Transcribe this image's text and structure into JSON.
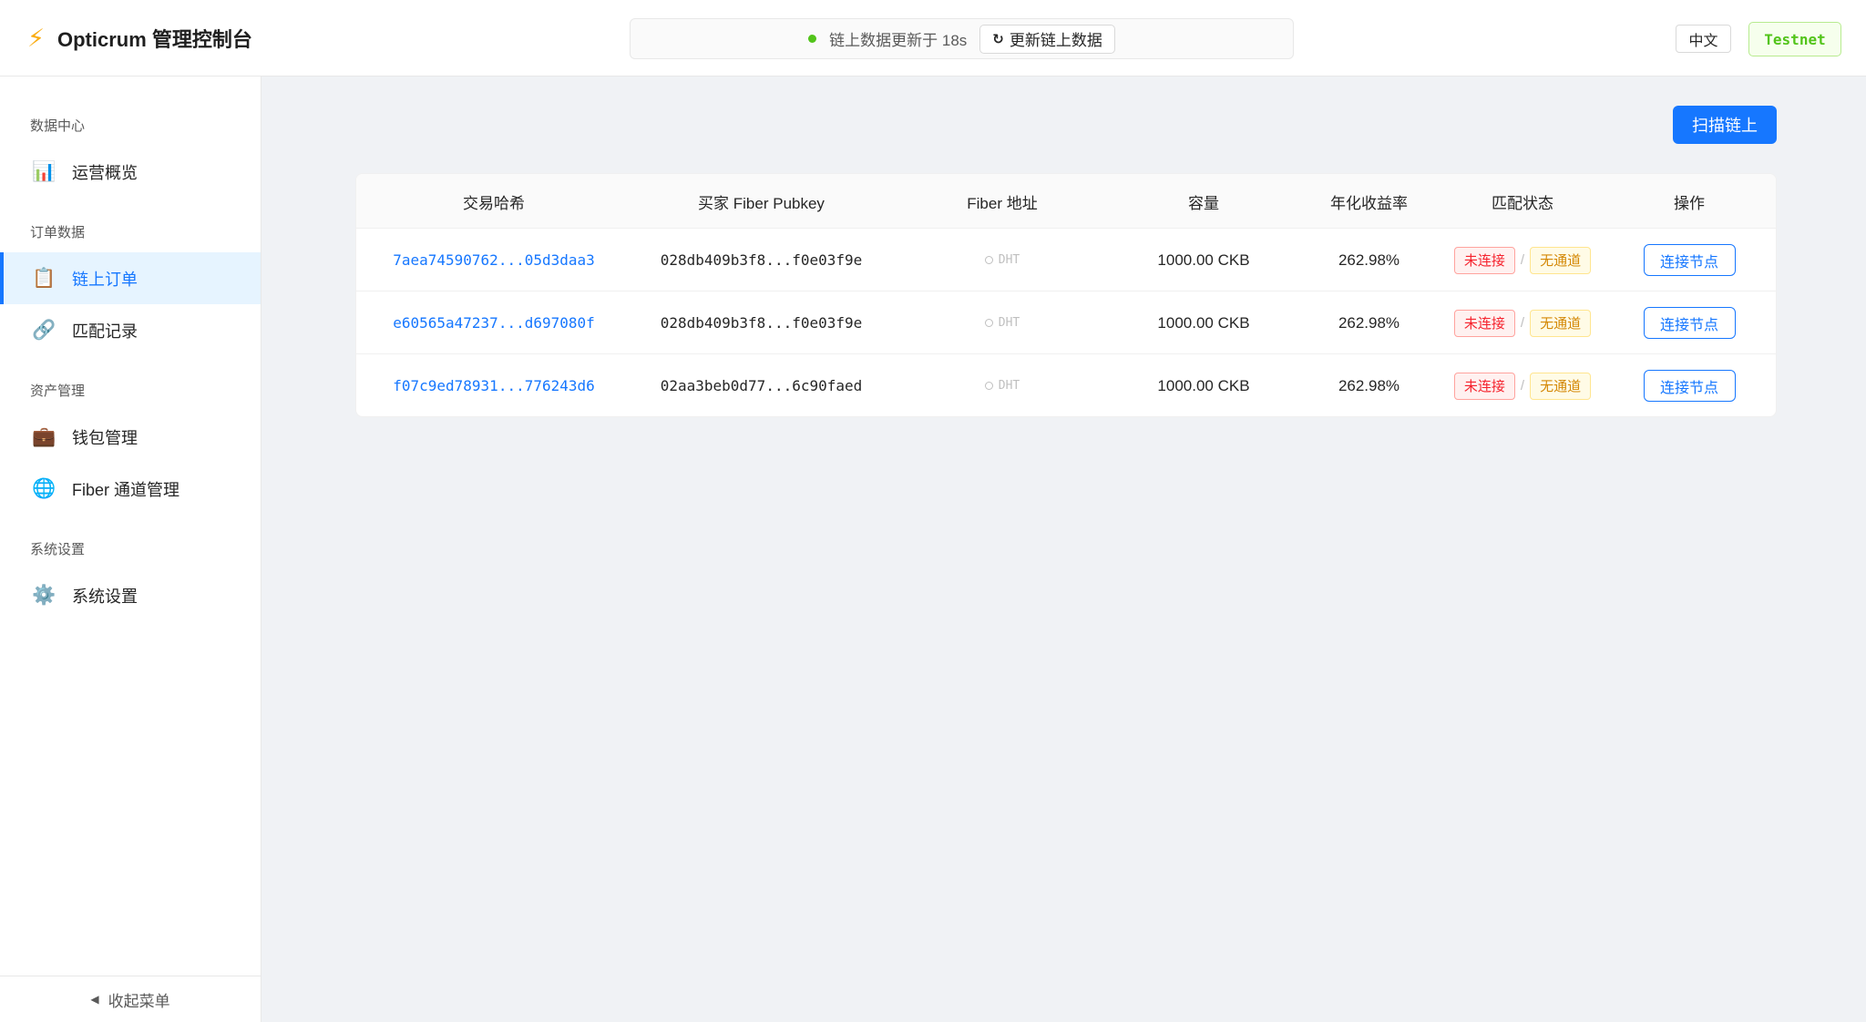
{
  "header": {
    "brand_icon": "lightning-icon",
    "title": "Opticrum 管理控制台",
    "sync_status": "链上数据更新于 18s",
    "refresh_label": "更新链上数据",
    "language_label": "中文",
    "network_label": "Testnet"
  },
  "sidebar": {
    "groups": [
      {
        "title": "数据中心",
        "items": [
          {
            "label": "运营概览",
            "icon": "bar-chart-icon"
          }
        ]
      },
      {
        "title": "订单数据",
        "items": [
          {
            "label": "链上订单",
            "icon": "clipboard-icon",
            "active": true
          },
          {
            "label": "匹配记录",
            "icon": "link-icon"
          }
        ]
      },
      {
        "title": "资产管理",
        "items": [
          {
            "label": "钱包管理",
            "icon": "briefcase-icon"
          },
          {
            "label": "Fiber 通道管理",
            "icon": "globe-icon"
          }
        ]
      },
      {
        "title": "系统设置",
        "items": [
          {
            "label": "系统设置",
            "icon": "gear-icon"
          }
        ]
      }
    ],
    "collapse_label": "收起菜单"
  },
  "main": {
    "scan_label": "扫描链上",
    "table": {
      "columns": [
        "交易哈希",
        "买家 Fiber Pubkey",
        "Fiber 地址",
        "容量",
        "年化收益率",
        "匹配状态",
        "操作"
      ],
      "rows": [
        {
          "tx_hash": "7aea74590762...05d3daa3",
          "pubkey": "028db409b3f8...f0e03f9e",
          "address": "DHT",
          "capacity": "1000.00 CKB",
          "apy": "262.98%",
          "status_connection": "未连接",
          "status_channel": "无通道",
          "action": "连接节点"
        },
        {
          "tx_hash": "e60565a47237...d697080f",
          "pubkey": "028db409b3f8...f0e03f9e",
          "address": "DHT",
          "capacity": "1000.00 CKB",
          "apy": "262.98%",
          "status_connection": "未连接",
          "status_channel": "无通道",
          "action": "连接节点"
        },
        {
          "tx_hash": "f07c9ed78931...776243d6",
          "pubkey": "02aa3beb0d77...6c90faed",
          "address": "DHT",
          "capacity": "1000.00 CKB",
          "apy": "262.98%",
          "status_connection": "未连接",
          "status_channel": "无通道",
          "action": "连接节点"
        }
      ]
    }
  },
  "colors": {
    "primary": "#1677ff",
    "success": "#52c41a",
    "danger": "#f5222d",
    "warning": "#d48806"
  }
}
